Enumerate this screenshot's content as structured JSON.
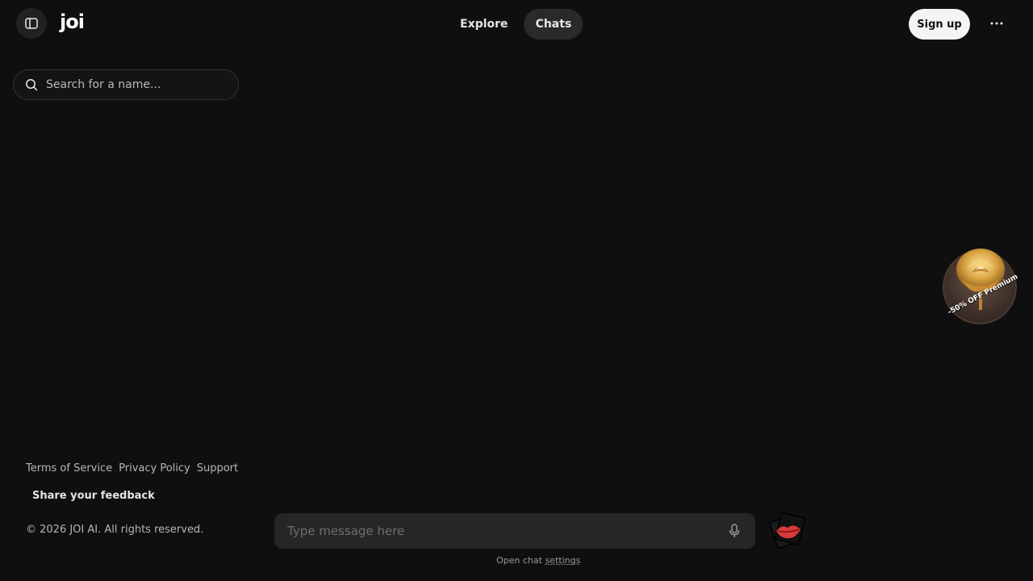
{
  "header": {
    "logo": "joi",
    "nav": [
      {
        "label": "Explore",
        "active": false
      },
      {
        "label": "Chats",
        "active": true
      }
    ],
    "signup_label": "Sign up"
  },
  "search": {
    "placeholder": "Search for a name..."
  },
  "footer": {
    "links": [
      "Terms of Service",
      "Privacy Policy",
      "Support"
    ],
    "feedback": "Share your feedback",
    "copyright": "© 2026 JOI AI. All rights reserved."
  },
  "composer": {
    "placeholder": "Type message here",
    "settings_prefix": "Open chat",
    "settings_link": "settings"
  },
  "promo": {
    "label": "-50% OFF Premium"
  },
  "colors": {
    "background": "#0f0f0f",
    "surface": "#262626",
    "accent_button": "#f4f4f4",
    "kiss": "#d83a3a",
    "rose_gold": "#d9a441"
  },
  "icons": {
    "sidebar": "sidebar-panel-icon",
    "search": "search-icon",
    "more": "more-horizontal-icon",
    "mic": "microphone-icon",
    "kiss": "kiss-lips-icon",
    "promo": "golden-rose-icon"
  }
}
